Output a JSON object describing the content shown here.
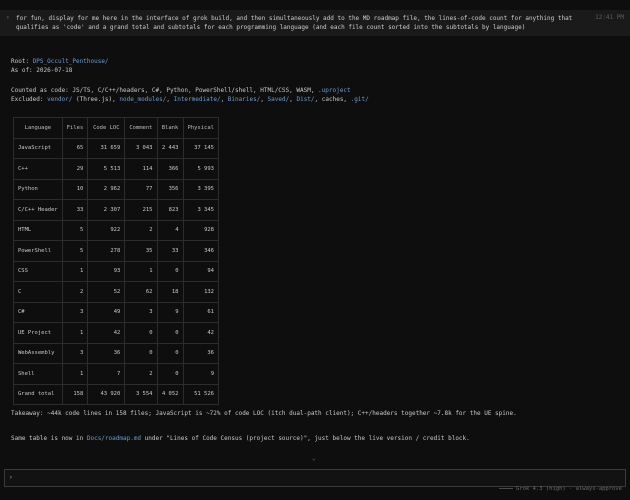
{
  "prompt": {
    "chevron": "›",
    "text": "for fun, display for me here in the interface of grok build, and then simultaneously add to the MD roadmap file, the lines-of-code count for anything that qualifies as 'code' and a grand total and subtotals for each programming language (and each file count sorted into the subtotals by language)",
    "time": "12:41 PM"
  },
  "summary": {
    "root_label": "Root: ",
    "root_path": "DPS_Occult_Penthouse/",
    "as_of": "As of: 2026-07-18",
    "counted_label": "Counted as code: JS/TS, C/C++/headers, C#, Python, PowerShell/shell, HTML/CSS, WASM, ",
    "counted_uproject": ".uproject",
    "excluded_label": "Excluded: ",
    "excluded_vendor": "vendor/",
    "excluded_vendor_note": " (Three.js), ",
    "excluded_node_modules": "node_modules/",
    "sep1": ", ",
    "excluded_intermediate": "Intermediate/",
    "sep2": ", ",
    "excluded_binaries": "Binaries/",
    "sep3": ", ",
    "excluded_saved": "Saved/",
    "sep4": ", ",
    "excluded_dist": "Dist/",
    "excluded_tail": ", caches, ",
    "excluded_git": ".git/"
  },
  "table": {
    "headers": [
      "Language",
      "Files",
      "Code LOC",
      "Comment",
      "Blank",
      "Physical"
    ],
    "rows": [
      [
        "JavaScript",
        "65",
        "31 659",
        "3 043",
        "2 443",
        "37 145"
      ],
      [
        "C++",
        "29",
        "5 513",
        "114",
        "366",
        "5 993"
      ],
      [
        "Python",
        "10",
        "2 962",
        "77",
        "356",
        "3 395"
      ],
      [
        "C/C++ Header",
        "33",
        "2 307",
        "215",
        "823",
        "3 345"
      ],
      [
        "HTML",
        "5",
        "922",
        "2",
        "4",
        "928"
      ],
      [
        "PowerShell",
        "5",
        "278",
        "35",
        "33",
        "346"
      ],
      [
        "CSS",
        "1",
        "93",
        "1",
        "0",
        "94"
      ],
      [
        "C",
        "2",
        "52",
        "62",
        "18",
        "132"
      ],
      [
        "C#",
        "3",
        "49",
        "3",
        "9",
        "61"
      ],
      [
        "UE Project",
        "1",
        "42",
        "0",
        "0",
        "42"
      ],
      [
        "WebAssembly",
        "3",
        "36",
        "0",
        "0",
        "36"
      ],
      [
        "Shell",
        "1",
        "7",
        "2",
        "0",
        "9"
      ],
      [
        "Grand total",
        "158",
        "43 920",
        "3 554",
        "4 052",
        "51 526"
      ]
    ]
  },
  "takeaway": "Takeaway: ~44k code lines in 158 files; JavaScript is ~72% of code LOC (itch dual-path client); C++/headers together ~7.8k for the UE spine.",
  "roadmap_note": {
    "prefix": "Same table is now in ",
    "path": "Docs/roadmap.md",
    "suffix": " under \"Lines of Code Census (project source)\", just below the live version / credit block."
  },
  "scroll_hint": "⌄",
  "input": {
    "chevron": "›",
    "value": ""
  },
  "status": {
    "model": "Grok 4.3 (high) · always-approve"
  }
}
